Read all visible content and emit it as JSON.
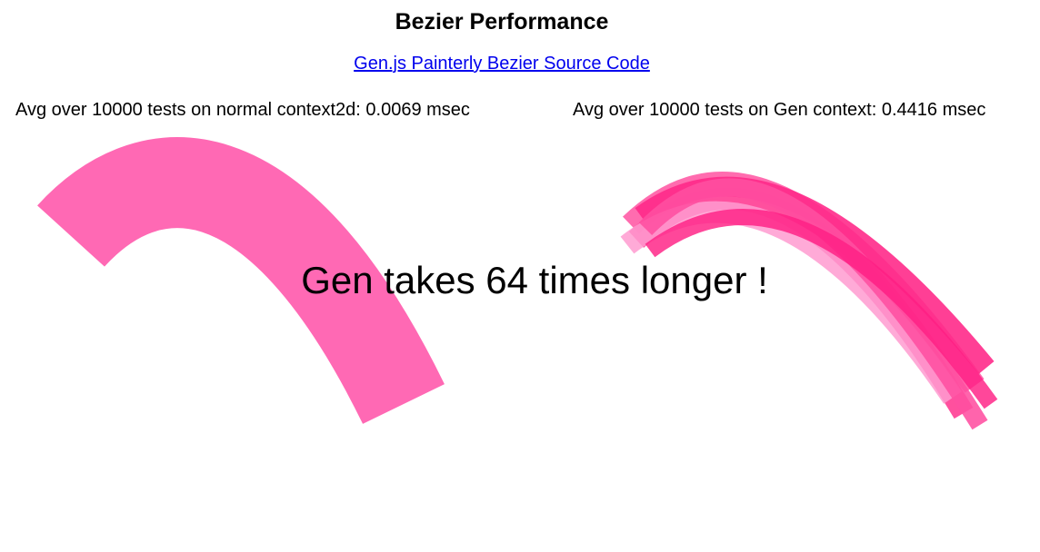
{
  "page": {
    "title": "Bezier Performance",
    "link_text": "Gen.js Painterly Bezier Source Code",
    "left_stat": "Avg over 10000 tests on normal context2d: 0.0069 msec",
    "right_stat": "Avg over 10000 tests on Gen context: 0.4416 msec",
    "verdict": "Gen takes 64 times longer !"
  },
  "colors": {
    "normal_stroke": "#ff69b4",
    "gen_strokes": [
      "#ff5fa8",
      "#ff3d94",
      "#ff2a8a",
      "#ff9bd0",
      "#ff4fa0",
      "#ff1f84"
    ]
  },
  "icons": {
    "normal_curve": "bezier-stroke",
    "gen_curve": "painterly-bezier-strokes"
  }
}
